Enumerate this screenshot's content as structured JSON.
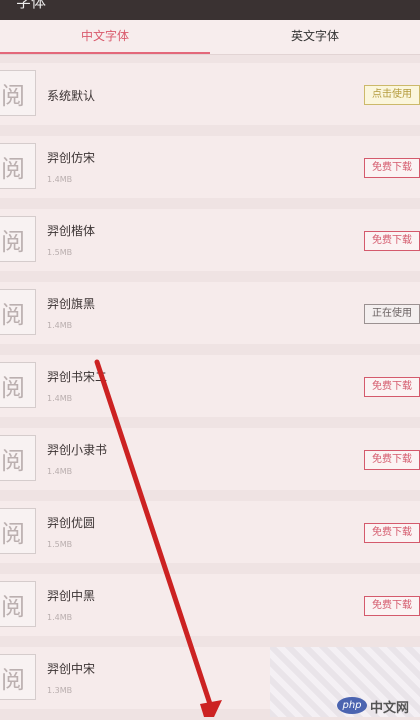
{
  "header": {
    "title": "字体"
  },
  "tabs": [
    {
      "label": "中文字体",
      "active": true
    },
    {
      "label": "英文字体",
      "active": false
    }
  ],
  "thumb_glyph": "阅",
  "fonts": [
    {
      "name": "系统默认",
      "size": "",
      "button": "点击使用",
      "state": "use"
    },
    {
      "name": "羿创仿宋",
      "size": "1.4MB",
      "button": "免费下载",
      "state": "download"
    },
    {
      "name": "羿创楷体",
      "size": "1.5MB",
      "button": "免费下载",
      "state": "download"
    },
    {
      "name": "羿创旗黑",
      "size": "1.4MB",
      "button": "正在使用",
      "state": "inuse"
    },
    {
      "name": "羿创书宋二",
      "size": "1.4MB",
      "button": "免费下载",
      "state": "download"
    },
    {
      "name": "羿创小隶书",
      "size": "1.4MB",
      "button": "免费下载",
      "state": "download"
    },
    {
      "name": "羿创优圆",
      "size": "1.5MB",
      "button": "免费下载",
      "state": "download"
    },
    {
      "name": "羿创中黑",
      "size": "1.4MB",
      "button": "免费下载",
      "state": "download"
    },
    {
      "name": "羿创中宋",
      "size": "1.3MB",
      "button": "",
      "state": ""
    }
  ],
  "watermark": {
    "logo": "php",
    "text": "中文网"
  },
  "colors": {
    "accent": "#d95a6c",
    "arrow": "#cc2222",
    "background": "#efe3e3"
  }
}
